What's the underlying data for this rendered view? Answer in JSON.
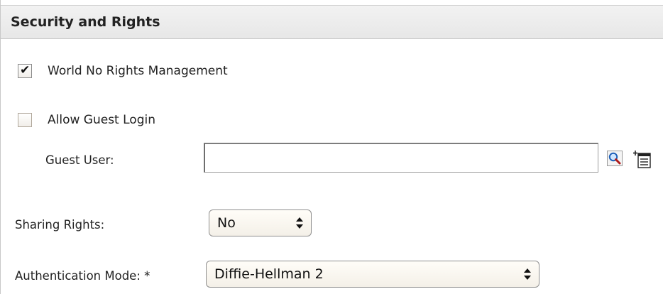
{
  "section": {
    "title": "Security and Rights"
  },
  "world_rights": {
    "label": "World No Rights Management",
    "checked": true
  },
  "guest_login": {
    "label": "Allow Guest Login",
    "checked": false
  },
  "guest_user": {
    "label": "Guest User:",
    "value": "",
    "search_icon": "magnifier-icon",
    "browse_icon": "list-picker-icon"
  },
  "sharing_rights": {
    "label": "Sharing Rights:",
    "selected": "No"
  },
  "authentication_mode": {
    "label": "Authentication Mode: *",
    "selected": "Diffie-Hellman 2"
  }
}
